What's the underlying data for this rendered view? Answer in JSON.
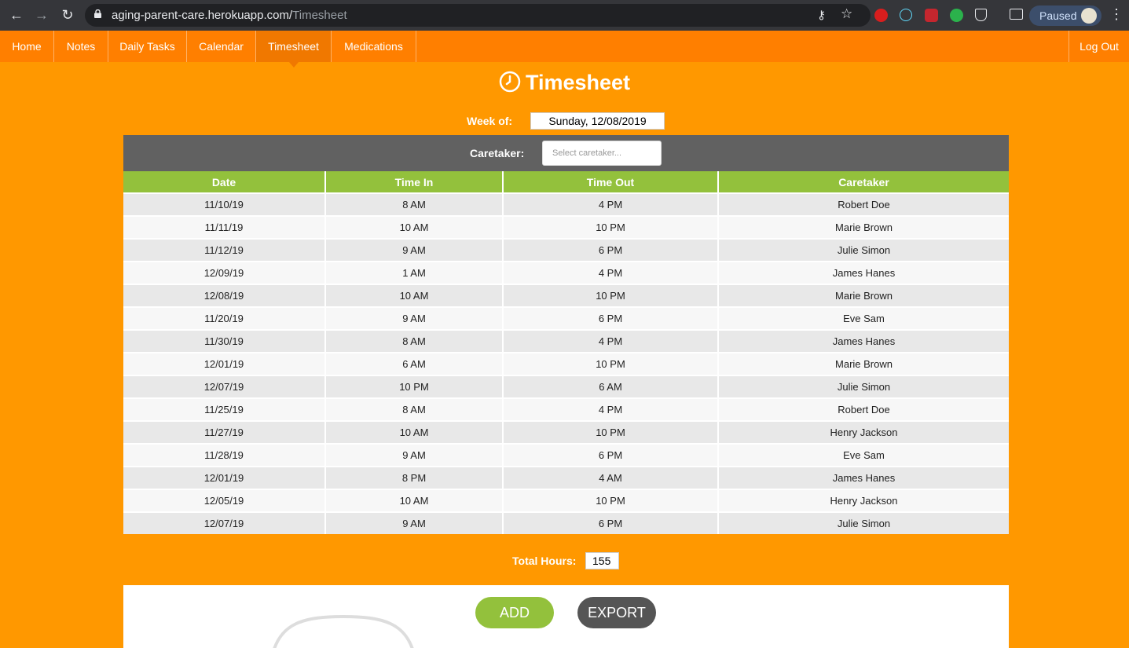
{
  "browser": {
    "url_host": "aging-parent-care.herokuapp.com/",
    "url_path": "Timesheet",
    "profile_status": "Paused"
  },
  "nav": {
    "items": [
      {
        "label": "Home"
      },
      {
        "label": "Notes"
      },
      {
        "label": "Daily Tasks"
      },
      {
        "label": "Calendar"
      },
      {
        "label": "Timesheet"
      },
      {
        "label": "Medications"
      }
    ],
    "active": "Timesheet",
    "logout": "Log Out"
  },
  "page": {
    "title": "Timesheet",
    "week_label": "Week of:",
    "week_value": "Sunday, 12/08/2019",
    "caretaker_label": "Caretaker:",
    "caretaker_placeholder": "Select caretaker...",
    "total_label": "Total Hours:",
    "total_value": "155",
    "add_button": "ADD",
    "export_button": "EXPORT"
  },
  "table": {
    "headers": [
      "Date",
      "Time In",
      "Time Out",
      "Caretaker"
    ],
    "rows": [
      [
        "11/10/19",
        "8 AM",
        "4 PM",
        "Robert Doe"
      ],
      [
        "11/11/19",
        "10 AM",
        "10 PM",
        "Marie Brown"
      ],
      [
        "11/12/19",
        "9 AM",
        "6 PM",
        "Julie Simon"
      ],
      [
        "12/09/19",
        "1 AM",
        "4 PM",
        "James Hanes"
      ],
      [
        "12/08/19",
        "10 AM",
        "10 PM",
        "Marie Brown"
      ],
      [
        "11/20/19",
        "9 AM",
        "6 PM",
        "Eve Sam"
      ],
      [
        "11/30/19",
        "8 AM",
        "4 PM",
        "James Hanes"
      ],
      [
        "12/01/19",
        "6 AM",
        "10 PM",
        "Marie Brown"
      ],
      [
        "12/07/19",
        "10 PM",
        "6 AM",
        "Julie Simon"
      ],
      [
        "11/25/19",
        "8 AM",
        "4 PM",
        "Robert Doe"
      ],
      [
        "11/27/19",
        "10 AM",
        "10 PM",
        "Henry Jackson"
      ],
      [
        "11/28/19",
        "9 AM",
        "6 PM",
        "Eve Sam"
      ],
      [
        "12/01/19",
        "8 PM",
        "4 AM",
        "James Hanes"
      ],
      [
        "12/05/19",
        "10 AM",
        "10 PM",
        "Henry Jackson"
      ],
      [
        "12/07/19",
        "9 AM",
        "6 PM",
        "Julie Simon"
      ]
    ]
  },
  "colors": {
    "page_bg": "#ff9800",
    "nav_bg": "#ff7f00",
    "header_green": "#93c13c",
    "caretaker_bar": "#616161",
    "export_gray": "#555555"
  }
}
